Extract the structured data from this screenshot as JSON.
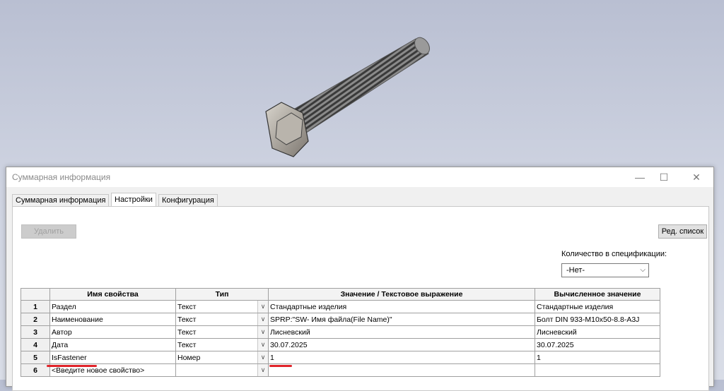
{
  "dialog": {
    "title": "Суммарная информация",
    "minimize_icon": "minimize-icon",
    "maximize_icon": "maximize-icon",
    "close_icon": "close-icon",
    "minimize_glyph": "—",
    "maximize_glyph": "☐",
    "close_glyph": "✕"
  },
  "tabs": [
    "Суммарная информация",
    "Настройки",
    "Конфигурация"
  ],
  "active_tab": "Настройки",
  "toolbar": {
    "delete_label": "Удалить",
    "quantity_label": "Количество в спецификации:",
    "quantity_value": "-Нет-",
    "edit_list_label": "Ред. список"
  },
  "table": {
    "headers": [
      "",
      "Имя свойства",
      "Тип",
      "Значение / Текстовое выражение",
      "Вычисленное значение"
    ],
    "rows": [
      {
        "num": "1",
        "name": "Раздел",
        "type": "Текст",
        "value": "Стандартные изделия",
        "computed": "Стандартные изделия"
      },
      {
        "num": "2",
        "name": "Наименование",
        "type": "Текст",
        "value": "SPRP:\"SW- Имя файла(File Name)\"",
        "computed": "Болт DIN 933-M10x50-8.8-A3J"
      },
      {
        "num": "3",
        "name": "Автор",
        "type": "Текст",
        "value": "Лисневский",
        "computed": "Лисневский"
      },
      {
        "num": "4",
        "name": "Дата",
        "type": "Текст",
        "value": "30.07.2025",
        "computed": "30.07.2025"
      },
      {
        "num": "5",
        "name": "IsFastener",
        "type": "Номер",
        "value": "1",
        "computed": "1"
      },
      {
        "num": "6",
        "name": "<Введите новое свойство>",
        "type": "",
        "value": "",
        "computed": ""
      }
    ]
  },
  "colors": {
    "annotation_red": "#e0242a",
    "background": "#cdd2e0"
  }
}
